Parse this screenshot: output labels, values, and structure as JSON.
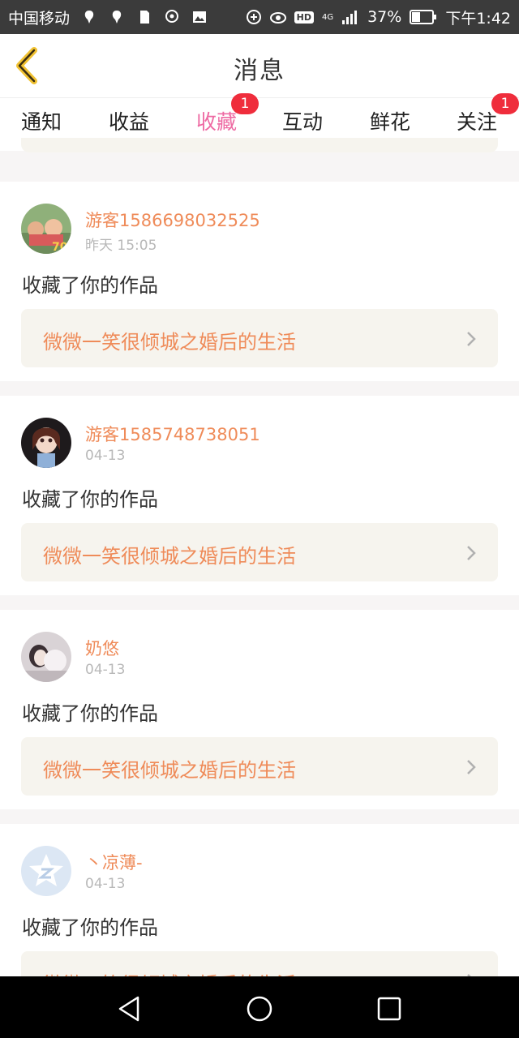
{
  "status_bar": {
    "carrier": "中国移动",
    "hd_badge": "HD",
    "network": "4G",
    "battery": "37%",
    "time": "下午1:42"
  },
  "header": {
    "title": "消息",
    "back_icon": "chevron-left-icon",
    "accent_color": "#f1c232"
  },
  "tabs": [
    {
      "label": "通知"
    },
    {
      "label": "收益"
    },
    {
      "label": "收藏",
      "active": true,
      "badge": "1"
    },
    {
      "label": "互动"
    },
    {
      "label": "鲜花"
    },
    {
      "label": "关注",
      "badge": "1"
    }
  ],
  "items": [
    {
      "username": "游客1586698032525",
      "time": "昨天 15:05",
      "action": "收藏了你的作品",
      "work_title": "微微一笑很倾城之婚后的生活"
    },
    {
      "username": "游客1585748738051",
      "time": "04-13",
      "action": "收藏了你的作品",
      "work_title": "微微一笑很倾城之婚后的生活"
    },
    {
      "username": "奶悠",
      "time": "04-13",
      "action": "收藏了你的作品",
      "work_title": "微微一笑很倾城之婚后的生活"
    },
    {
      "username": "丶凉薄-",
      "time": "04-13",
      "action": "收藏了你的作品",
      "work_title": "微微一笑很倾城之婚后的生活"
    }
  ],
  "colors": {
    "tab_active": "#ee6aa3",
    "badge": "#ef2d3c",
    "username": "#ef8b59",
    "work_bg": "#f6f4ee"
  },
  "nav": {
    "back": "triangle-back-icon",
    "home": "circle-home-icon",
    "recents": "square-recents-icon"
  }
}
